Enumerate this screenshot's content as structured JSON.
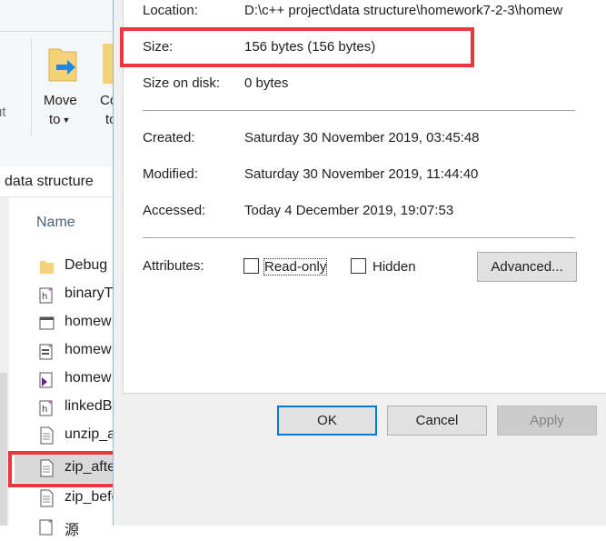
{
  "explorer": {
    "ribbon": {
      "cut_label": "ut",
      "move_label": "Move",
      "move_to": "to",
      "copy_label": "Co",
      "copy_to": "to"
    },
    "address": "data structure",
    "column_name": "Name",
    "files": [
      {
        "name": "Debug",
        "icon": "folder-icon"
      },
      {
        "name": "binaryT",
        "icon": "cpp-header-icon"
      },
      {
        "name": "homew",
        "icon": "vs-filters-icon"
      },
      {
        "name": "homew",
        "icon": "vs-project-icon"
      },
      {
        "name": "homew",
        "icon": "vs-solution-icon"
      },
      {
        "name": "linkedB",
        "icon": "cpp-header-icon"
      },
      {
        "name": "unzip_a",
        "icon": "text-file-icon"
      },
      {
        "name": "zip_after.txt",
        "icon": "text-file-icon",
        "selected": true
      },
      {
        "name": "zip_before.txt",
        "icon": "text-file-icon"
      },
      {
        "name": "源",
        "icon": "cpp-source-icon"
      }
    ]
  },
  "dialog": {
    "location_label": "Location:",
    "location_value": "D:\\c++ project\\data structure\\homework7-2-3\\homew",
    "size_label": "Size:",
    "size_value": "156 bytes (156 bytes)",
    "size_on_disk_label": "Size on disk:",
    "size_on_disk_value": "0 bytes",
    "created_label": "Created:",
    "created_value": "Saturday 30 November 2019, 03:45:48",
    "modified_label": "Modified:",
    "modified_value": "Saturday 30 November 2019, 11:44:40",
    "accessed_label": "Accessed:",
    "accessed_value": "Today 4 December 2019, 19:07:53",
    "attributes_label": "Attributes:",
    "readonly_label": "Read-only",
    "readonly_checked": false,
    "hidden_label": "Hidden",
    "hidden_checked": false,
    "advanced_label": "Advanced...",
    "ok_label": "OK",
    "cancel_label": "Cancel",
    "apply_label": "Apply"
  },
  "colors": {
    "highlight": "#e8383d",
    "focus": "#0078d7"
  }
}
